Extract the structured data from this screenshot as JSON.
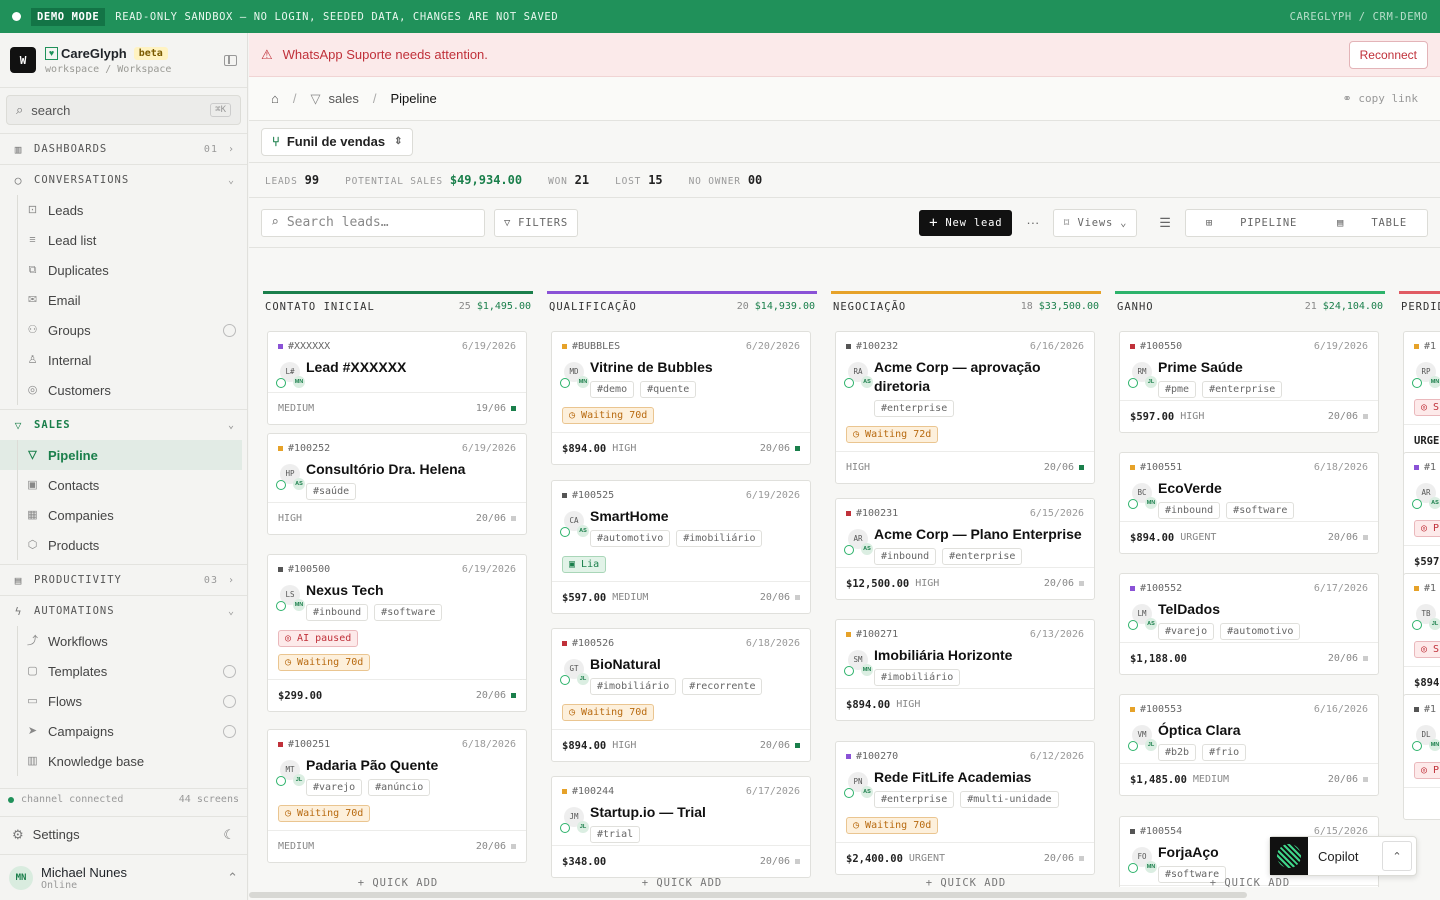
{
  "topbar": {
    "badge": "DEMO MODE",
    "message": "READ-ONLY SANDBOX — NO LOGIN, SEEDED DATA, CHANGES ARE NOT SAVED",
    "right": "CAREGLYPH / CRM-DEMO"
  },
  "brand": {
    "initial": "W",
    "name": "CareGlyph",
    "beta": "beta",
    "workspace": "workspace / Workspace"
  },
  "search": {
    "placeholder": "search",
    "kbd": "⌘K"
  },
  "sidebar": {
    "dashboards": {
      "label": "DASHBOARDS",
      "count": "01"
    },
    "conversations": {
      "label": "CONVERSATIONS",
      "items": [
        "Leads",
        "Lead list",
        "Duplicates",
        "Email",
        "Groups",
        "Internal",
        "Customers"
      ]
    },
    "sales": {
      "label": "SALES",
      "items": [
        "Pipeline",
        "Contacts",
        "Companies",
        "Products"
      ]
    },
    "productivity": {
      "label": "PRODUCTIVITY",
      "count": "03"
    },
    "automations": {
      "label": "AUTOMATIONS",
      "items": [
        "Workflows",
        "Templates",
        "Flows",
        "Campaigns",
        "Knowledge base"
      ]
    },
    "channel": {
      "status": "channel connected",
      "screens": "44 screens"
    },
    "settings": "Settings",
    "user": {
      "initials": "MN",
      "name": "Michael Nunes",
      "status": "Online"
    }
  },
  "alert": {
    "message": "WhatsApp Suporte needs attention.",
    "button": "Reconnect"
  },
  "breadcrumb": {
    "sales": "sales",
    "current": "Pipeline",
    "copy": "copy link"
  },
  "funnel": {
    "label": "Funil de vendas"
  },
  "stats": [
    {
      "label": "LEADS",
      "value": "99"
    },
    {
      "label": "POTENTIAL SALES",
      "value": "$49,934.00"
    },
    {
      "label": "WON",
      "value": "21"
    },
    {
      "label": "LOST",
      "value": "15"
    },
    {
      "label": "NO OWNER",
      "value": "00"
    }
  ],
  "toolbar": {
    "search_placeholder": "Search leads…",
    "filters": "FILTERS",
    "new_lead": "New lead",
    "more": "···",
    "views": "Views",
    "pipeline": "PIPELINE",
    "table": "TABLE"
  },
  "colors": {
    "accent": "#20915a",
    "contato": "#1a7f4b",
    "qualificacao": "#8a52d6",
    "negociacao": "#e6a229",
    "ganho": "#2db36b"
  },
  "columns": [
    {
      "name": "CONTATO INICIAL",
      "count": "25",
      "sum": "$1,495.00",
      "quick": "+ QUICK ADD",
      "cards": [
        {
          "id": "#XXXXXX",
          "date": "6/19/2026",
          "initials": "L#",
          "owner": "MN",
          "title": "Lead #XXXXXX",
          "tags": [],
          "pills": [],
          "amount": "",
          "priority": "MEDIUM",
          "due": "19/06"
        },
        {
          "id": "#100252",
          "date": "6/19/2026",
          "initials": "HP",
          "owner": "AS",
          "title": "Consultório Dra. Helena",
          "tags": [
            "#saúde"
          ],
          "pills": [],
          "amount": "",
          "priority": "HIGH",
          "due": "20/06"
        },
        {
          "id": "#100500",
          "date": "6/19/2026",
          "initials": "LS",
          "owner": "MN",
          "title": "Nexus Tech",
          "tags": [
            "#inbound",
            "#software"
          ],
          "pills": [
            "AI paused",
            "Waiting 70d"
          ],
          "amount": "$299.00",
          "priority": "",
          "due": "20/06"
        },
        {
          "id": "#100251",
          "date": "6/18/2026",
          "initials": "MT",
          "owner": "JL",
          "title": "Padaria Pão Quente",
          "tags": [
            "#varejo",
            "#anúncio"
          ],
          "pills": [
            "Waiting 70d"
          ],
          "amount": "",
          "priority": "MEDIUM",
          "due": "20/06"
        }
      ]
    },
    {
      "name": "QUALIFICAÇÃO",
      "count": "20",
      "sum": "$14,939.00",
      "quick": "+ QUICK ADD",
      "cards": [
        {
          "id": "#BUBBLES",
          "date": "6/20/2026",
          "initials": "MD",
          "owner": "MN",
          "title": "Vitrine de Bubbles",
          "tags": [
            "#demo",
            "#quente"
          ],
          "pills": [
            "Waiting 70d"
          ],
          "amount": "$894.00",
          "priority": "HIGH",
          "due": "20/06"
        },
        {
          "id": "#100525",
          "date": "6/19/2026",
          "initials": "CA",
          "owner": "AS",
          "title": "SmartHome",
          "tags": [
            "#automotivo",
            "#imobiliário"
          ],
          "pills": [
            "Lia"
          ],
          "amount": "$597.00",
          "priority": "MEDIUM",
          "due": "20/06"
        },
        {
          "id": "#100526",
          "date": "6/18/2026",
          "initials": "GT",
          "owner": "JL",
          "title": "BioNatural",
          "tags": [
            "#imobiliário",
            "#recorrente"
          ],
          "pills": [
            "Waiting 70d"
          ],
          "amount": "$894.00",
          "priority": "HIGH",
          "due": "20/06"
        },
        {
          "id": "#100244",
          "date": "6/17/2026",
          "initials": "JM",
          "owner": "JL",
          "title": "Startup.io — Trial",
          "tags": [
            "#trial"
          ],
          "pills": [],
          "amount": "$348.00",
          "priority": "",
          "due": "20/06"
        }
      ]
    },
    {
      "name": "NEGOCIAÇÃO",
      "count": "18",
      "sum": "$33,500.00",
      "quick": "+ QUICK ADD",
      "cards": [
        {
          "id": "#100232",
          "date": "6/16/2026",
          "initials": "RA",
          "owner": "AS",
          "title": "Acme Corp — aprovação diretoria",
          "tags": [
            "#enterprise"
          ],
          "pills": [
            "Waiting 72d"
          ],
          "amount": "",
          "priority": "HIGH",
          "due": "20/06"
        },
        {
          "id": "#100231",
          "date": "6/15/2026",
          "initials": "AR",
          "owner": "AS",
          "title": "Acme Corp — Plano Enterprise",
          "tags": [
            "#inbound",
            "#enterprise"
          ],
          "pills": [],
          "amount": "$12,500.00",
          "priority": "HIGH",
          "due": "20/06"
        },
        {
          "id": "#100271",
          "date": "6/13/2026",
          "initials": "SM",
          "owner": "MN",
          "title": "Imobiliária Horizonte",
          "tags": [
            "#imobiliário"
          ],
          "pills": [],
          "amount": "$894.00",
          "priority": "HIGH",
          "due": ""
        },
        {
          "id": "#100270",
          "date": "6/12/2026",
          "initials": "PN",
          "owner": "AS",
          "title": "Rede FitLife Academias",
          "tags": [
            "#enterprise",
            "#multi-unidade"
          ],
          "pills": [
            "Waiting 70d"
          ],
          "amount": "$2,400.00",
          "priority": "URGENT",
          "due": "20/06"
        }
      ]
    },
    {
      "name": "GANHO",
      "count": "21",
      "sum": "$24,104.00",
      "quick": "+ QUICK ADD",
      "cards": [
        {
          "id": "#100550",
          "date": "6/19/2026",
          "initials": "RM",
          "owner": "JL",
          "title": "Prime Saúde",
          "tags": [
            "#pme",
            "#enterprise"
          ],
          "pills": [],
          "amount": "$597.00",
          "priority": "HIGH",
          "due": "20/06"
        },
        {
          "id": "#100551",
          "date": "6/18/2026",
          "initials": "BC",
          "owner": "MN",
          "title": "EcoVerde",
          "tags": [
            "#inbound",
            "#software"
          ],
          "pills": [],
          "amount": "$894.00",
          "priority": "URGENT",
          "due": "20/06"
        },
        {
          "id": "#100552",
          "date": "6/17/2026",
          "initials": "LM",
          "owner": "AS",
          "title": "TelDados",
          "tags": [
            "#varejo",
            "#automotivo"
          ],
          "pills": [],
          "amount": "$1,188.00",
          "priority": "",
          "due": "20/06"
        },
        {
          "id": "#100553",
          "date": "6/16/2026",
          "initials": "VM",
          "owner": "JL",
          "title": "Óptica Clara",
          "tags": [
            "#b2b",
            "#frio"
          ],
          "pills": [],
          "amount": "$1,485.00",
          "priority": "MEDIUM",
          "due": "20/06"
        },
        {
          "id": "#100554",
          "date": "6/15/2026",
          "initials": "FO",
          "owner": "MN",
          "title": "ForjaAço",
          "tags": [
            "#software"
          ],
          "pills": [],
          "amount": "",
          "priority": "",
          "due": ""
        }
      ]
    },
    {
      "name": "PERDIDO",
      "count": "",
      "sum": "",
      "quick": "",
      "cards": [
        {
          "id": "#1",
          "initials": "RP",
          "owner": "MN",
          "pill": "S",
          "text": "URGE"
        },
        {
          "id": "#1",
          "initials": "AR",
          "owner": "AS",
          "pill": "P",
          "text": "$597"
        },
        {
          "id": "#1",
          "initials": "TB",
          "owner": "JL",
          "pill": "S",
          "text": "$894"
        },
        {
          "id": "#1",
          "initials": "DL",
          "owner": "MN",
          "pill": "P",
          "text": ""
        }
      ]
    }
  ],
  "copilot": {
    "label": "Copilot"
  }
}
